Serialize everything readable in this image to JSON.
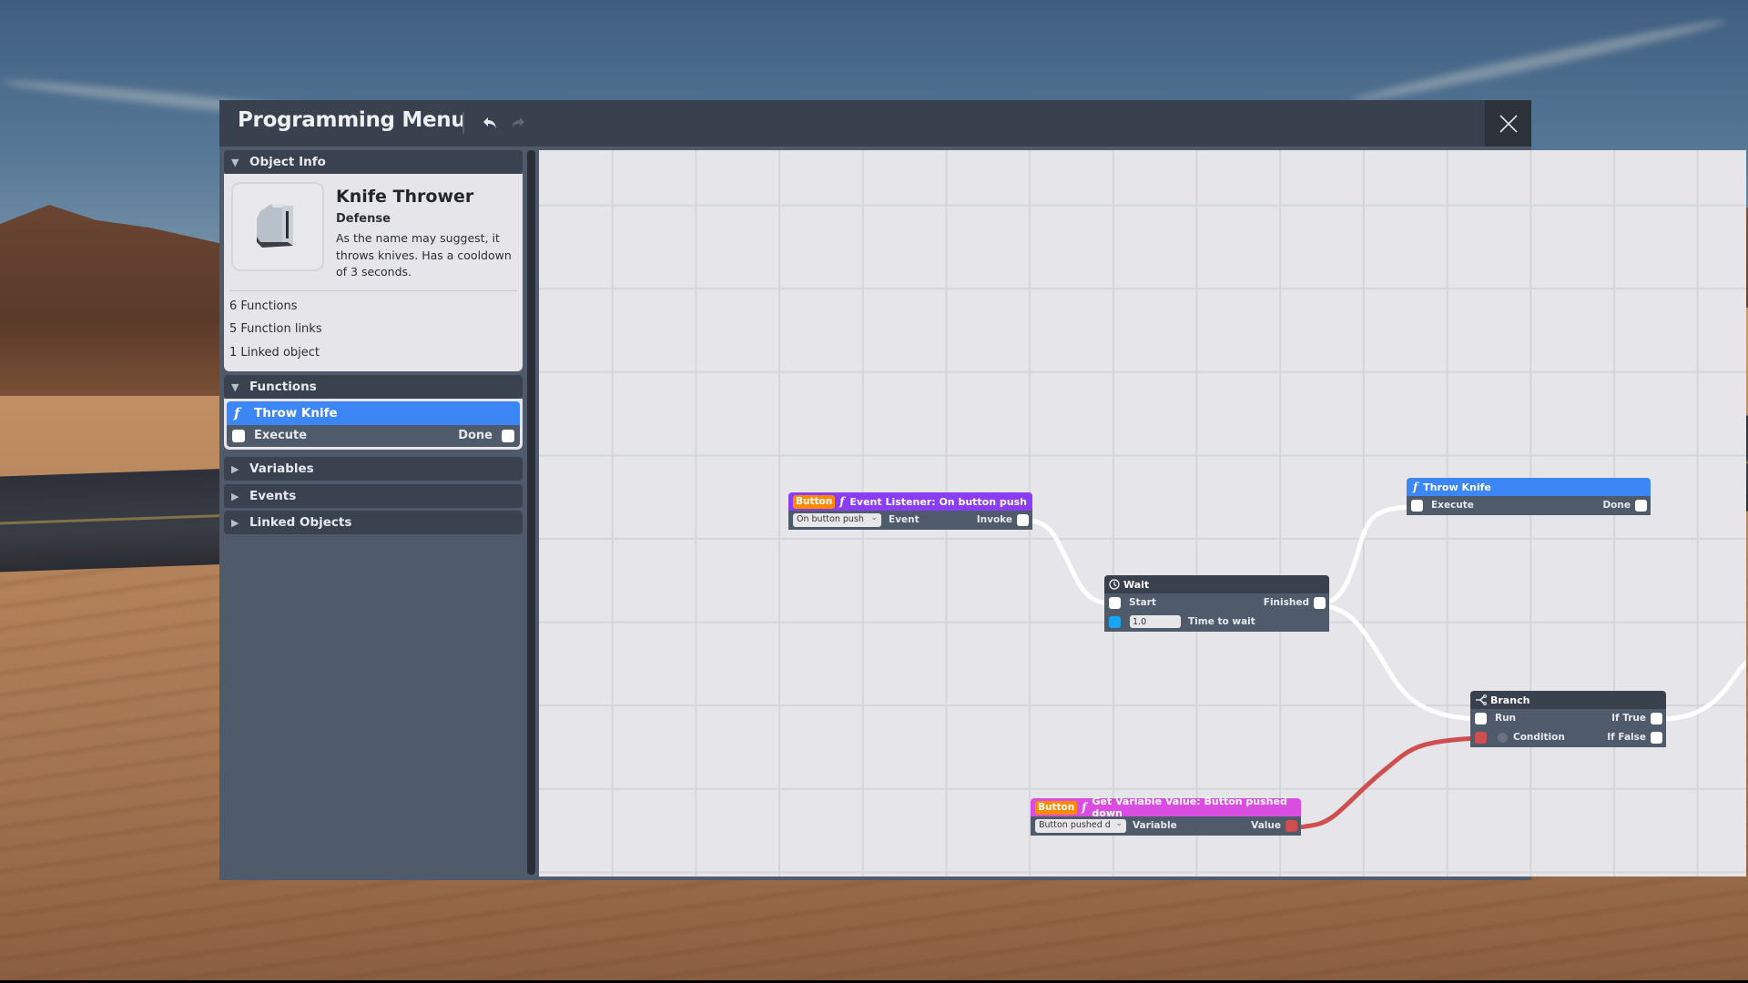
{
  "window": {
    "title": "Programming Menu",
    "undo_icon": "undo-arrow-icon",
    "redo_icon": "redo-arrow-icon",
    "close_icon": "close-x-icon"
  },
  "sidebar": {
    "object_info": {
      "header": "Object Info",
      "name": "Knife Thrower",
      "category": "Defense",
      "description": "As the name may suggest, it throws knives. Has a cooldown of 3 seconds.",
      "stats": [
        "6 Functions",
        "5 Function links",
        "1 Linked object"
      ]
    },
    "functions": {
      "header": "Functions",
      "items": [
        {
          "icon": "function-f-icon",
          "name": "Throw Knife",
          "input": "Execute",
          "output": "Done"
        }
      ]
    },
    "sections": [
      {
        "label": "Variables",
        "expanded": false
      },
      {
        "label": "Events",
        "expanded": false
      },
      {
        "label": "Linked Objects",
        "expanded": false
      }
    ]
  },
  "graph": {
    "nodes": {
      "event_listener": {
        "tag": "Button",
        "title": "Event Listener: On button push",
        "dropdown_value": "On button push",
        "input_label": "Event",
        "output_label": "Invoke",
        "header_color": "#8b3cf6"
      },
      "wait": {
        "title": "Wait",
        "input": "Start",
        "output": "Finished",
        "time_value": "1.0",
        "time_label": "Time to wait",
        "header_color": "#3a414e"
      },
      "throw_knife": {
        "title": "Throw Knife",
        "input": "Execute",
        "output": "Done",
        "header_color": "#3d86f5"
      },
      "branch": {
        "title": "Branch",
        "input_run": "Run",
        "input_condition": "Condition",
        "output_true": "If True",
        "output_false": "If False",
        "header_color": "#3a414e"
      },
      "get_variable": {
        "tag": "Button",
        "title": "Get Variable Value: Button pushed down",
        "dropdown_value": "Button pushed d",
        "input_label": "Variable",
        "output_label": "Value",
        "header_color": "#d94ee0"
      }
    },
    "links": [
      {
        "from": "event_listener.Invoke",
        "to": "wait.Start",
        "type": "exec"
      },
      {
        "from": "wait.Finished",
        "to": "throw_knife.Execute",
        "type": "exec"
      },
      {
        "from": "wait.Finished",
        "to": "branch.Run",
        "type": "exec"
      },
      {
        "from": "branch.If True",
        "to": "offscreen",
        "type": "exec"
      },
      {
        "from": "get_variable.Value",
        "to": "branch.Condition",
        "type": "boolean"
      }
    ],
    "colors": {
      "exec_wire": "#ffffff",
      "bool_wire": "#cd4f4f",
      "number_port": "#18a5f3",
      "tag": "#ff8a00"
    }
  }
}
